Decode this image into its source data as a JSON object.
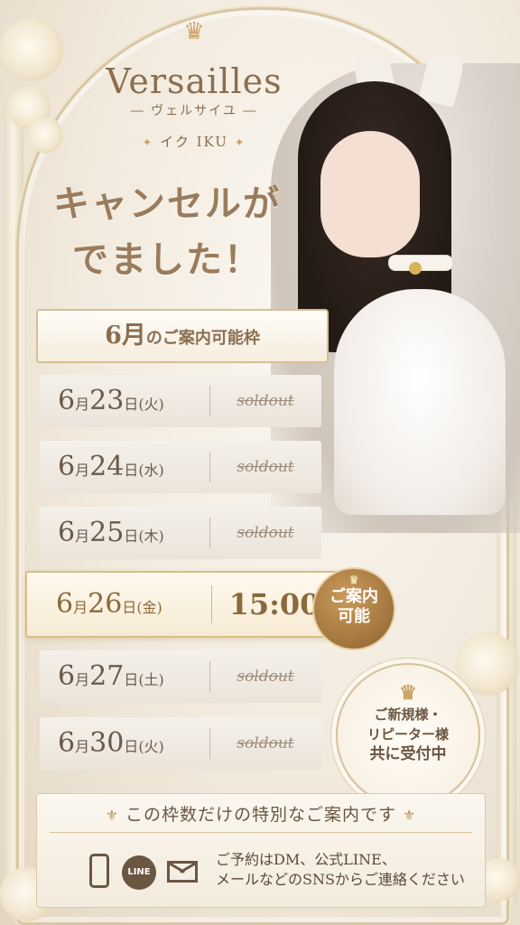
{
  "logo": {
    "crown_icon": "crown-icon",
    "brand": "Versailles",
    "kana": "― ヴェルサイユ ―",
    "name_prefix": "✦",
    "name": "イク IKU",
    "name_suffix": "✦"
  },
  "headline": {
    "line1": "キャンセルが",
    "line2": "でました！"
  },
  "schedule": {
    "title_month": "6月",
    "title_rest": "のご案内可能枠",
    "rows": [
      {
        "month": "6",
        "mon_unit": "月",
        "day": "23",
        "day_unit": "日",
        "weekday": "(火)",
        "status": "soldout"
      },
      {
        "month": "6",
        "mon_unit": "月",
        "day": "24",
        "day_unit": "日",
        "weekday": "(水)",
        "status": "soldout"
      },
      {
        "month": "6",
        "mon_unit": "月",
        "day": "25",
        "day_unit": "日",
        "weekday": "(木)",
        "status": "soldout"
      },
      {
        "month": "6",
        "mon_unit": "月",
        "day": "26",
        "day_unit": "日",
        "weekday": "(金)",
        "status": "15:00"
      },
      {
        "month": "6",
        "mon_unit": "月",
        "day": "27",
        "day_unit": "日",
        "weekday": "(土)",
        "status": "soldout"
      },
      {
        "month": "6",
        "mon_unit": "月",
        "day": "30",
        "day_unit": "日",
        "weekday": "(火)",
        "status": "soldout"
      }
    ]
  },
  "badge": {
    "line1": "ご案内",
    "line2": "可能"
  },
  "seal": {
    "line1": "ご新規様・",
    "line2": "リピーター様",
    "line3": "共に受付中"
  },
  "footer": {
    "banner": "この枠数だけの特別なご案内です",
    "line_icon_text": "LINE",
    "contact_line1": "ご予約はDM、公式LINE、",
    "contact_line2": "メールなどのSNSからご連絡ください"
  },
  "colors": {
    "gold": "#c9a46a",
    "text": "#6f5a45",
    "badge": "#a77a42"
  }
}
